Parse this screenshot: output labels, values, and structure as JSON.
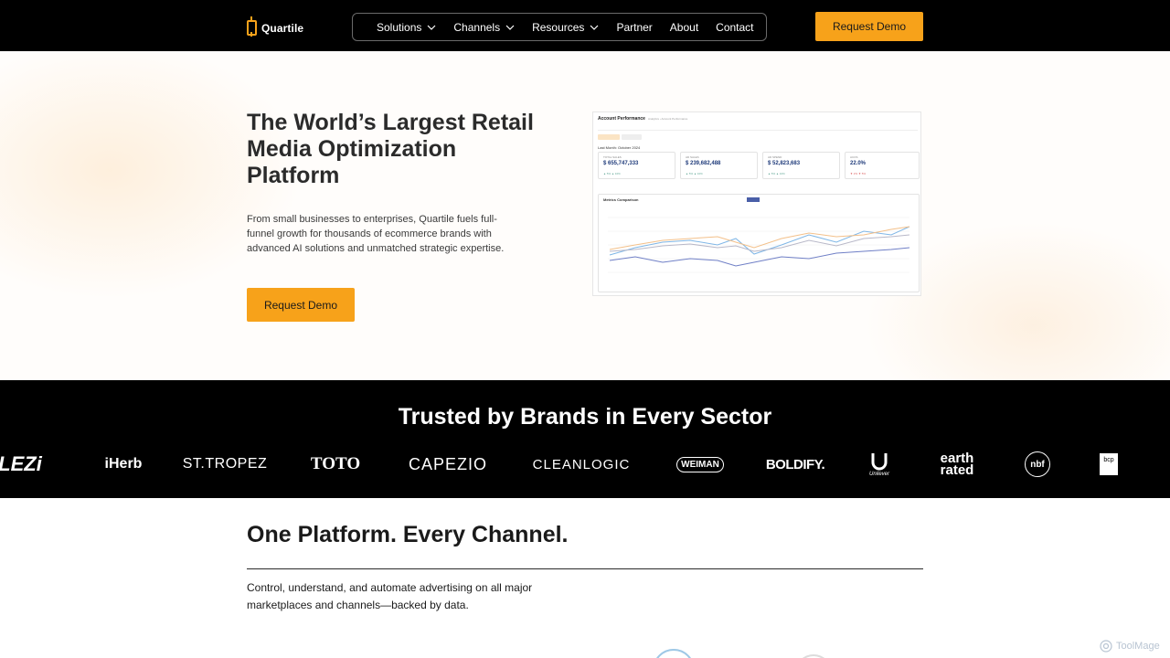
{
  "header": {
    "logo_text": "Quartile",
    "nav": [
      {
        "label": "Solutions",
        "dropdown": true
      },
      {
        "label": "Channels",
        "dropdown": true
      },
      {
        "label": "Resources",
        "dropdown": true
      },
      {
        "label": "Partner",
        "dropdown": false
      },
      {
        "label": "About",
        "dropdown": false
      },
      {
        "label": "Contact",
        "dropdown": false
      }
    ],
    "cta_label": "Request Demo"
  },
  "hero": {
    "title": "The World’s Largest Retail Media Optimization Platform",
    "subtitle": "From small businesses to enterprises, Quartile fuels full-funnel growth for thousands of ecommerce brands with advanced AI solutions and unmatched strategic expertise.",
    "cta_label": "Request Demo"
  },
  "dashboard": {
    "title": "Account Performance",
    "breadcrumb": "Analytics › Account Performance",
    "period": "Last Month: October 2024",
    "kpis": [
      {
        "label": "TOTAL SALES",
        "value": "$ 655,747,333",
        "foot": "▲ 5% ▲ 10%"
      },
      {
        "label": "AD SALES",
        "value": "$ 239,682,488",
        "foot": "▲ 5% ▲ 10%"
      },
      {
        "label": "AD SPEND",
        "value": "$ 52,823,683",
        "foot": "▲ 5% ▲ 10%"
      },
      {
        "label": "ACOS",
        "value": "22.0%",
        "foot": "▼ 2% ▼ 5%"
      }
    ],
    "chart_title": "Metrics Comparison"
  },
  "brands": {
    "title": "Trusted by Brands in Every Sector",
    "logos": [
      "LEZi",
      "iHerb",
      "ST.TROPEZ",
      "TOTO",
      "CAPEZIO",
      "CLEANLOGIC",
      "WEIMAN",
      "BOLDIFY.",
      "Unilever",
      "earth rated",
      "nbf",
      "bcp"
    ]
  },
  "channels": {
    "title": "One Platform. Every Channel.",
    "subtitle": "Control, understand, and automate advertising on all major marketplaces and channels—backed by data."
  },
  "watermark": "ToolMage",
  "colors": {
    "accent": "#f7a21a",
    "nav_bg": "#000000",
    "brand_strip_bg": "#000000"
  }
}
